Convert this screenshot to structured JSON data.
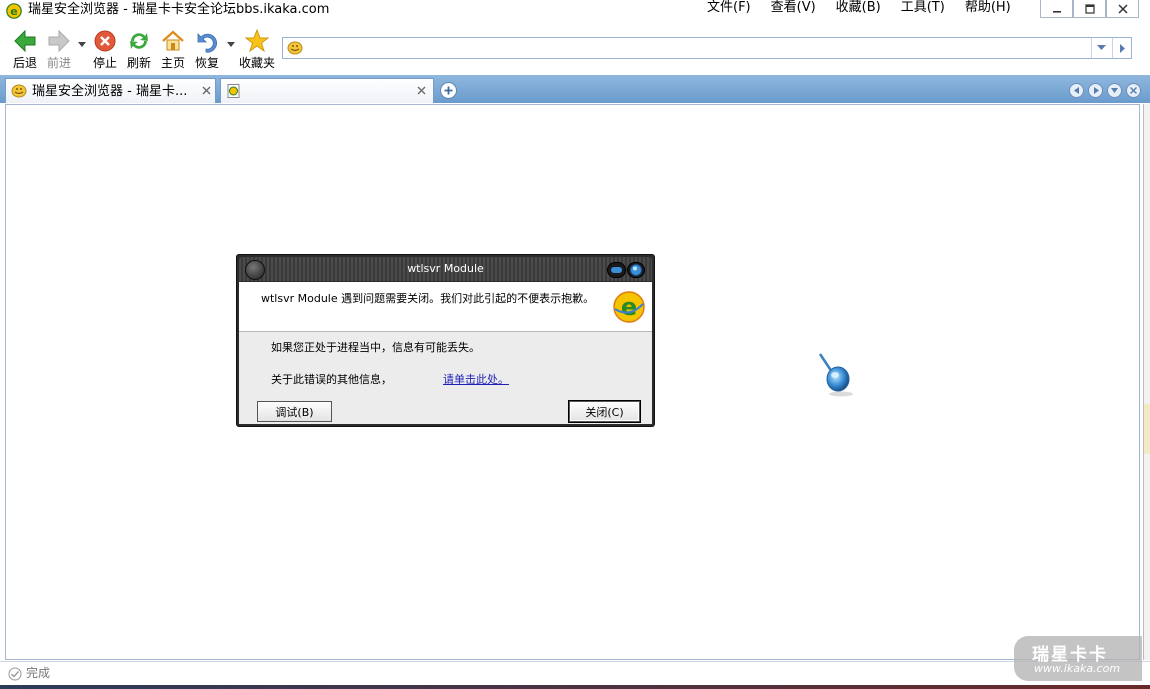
{
  "window": {
    "title": "瑞星安全浏览器 - 瑞星卡卡安全论坛bbs.ikaka.com",
    "menu": [
      "文件(F)",
      "查看(V)",
      "收藏(B)",
      "工具(T)",
      "帮助(H)"
    ]
  },
  "toolbar": {
    "back": "后退",
    "forward": "前进",
    "stop": "停止",
    "refresh": "刷新",
    "home": "主页",
    "restore": "恢复",
    "favorites": "收藏夹"
  },
  "address": {
    "value": "",
    "placeholder": ""
  },
  "tabs": [
    {
      "title": "瑞星安全浏览器 - 瑞星卡..."
    },
    {
      "title": ""
    }
  ],
  "status": {
    "text": "完成"
  },
  "watermark": {
    "logo": "瑞星卡卡",
    "url": "www.ikaka.com"
  },
  "dialog": {
    "title": "wtlsvr Module",
    "message": "wtlsvr Module 遇到问题需要关闭。我们对此引起的不便表示抱歉。",
    "info_line": "如果您正处于进程当中，信息有可能丢失。",
    "more_info": "关于此错误的其他信息，",
    "link": "请单击此处。",
    "debug_button": "调试(B)",
    "close_button": "关闭(C)"
  },
  "colors": {
    "tabbar": "#7aa6d4",
    "accent_green": "#3aa83a",
    "stop_red": "#e05a3a",
    "link_blue": "#1f1fb5"
  }
}
